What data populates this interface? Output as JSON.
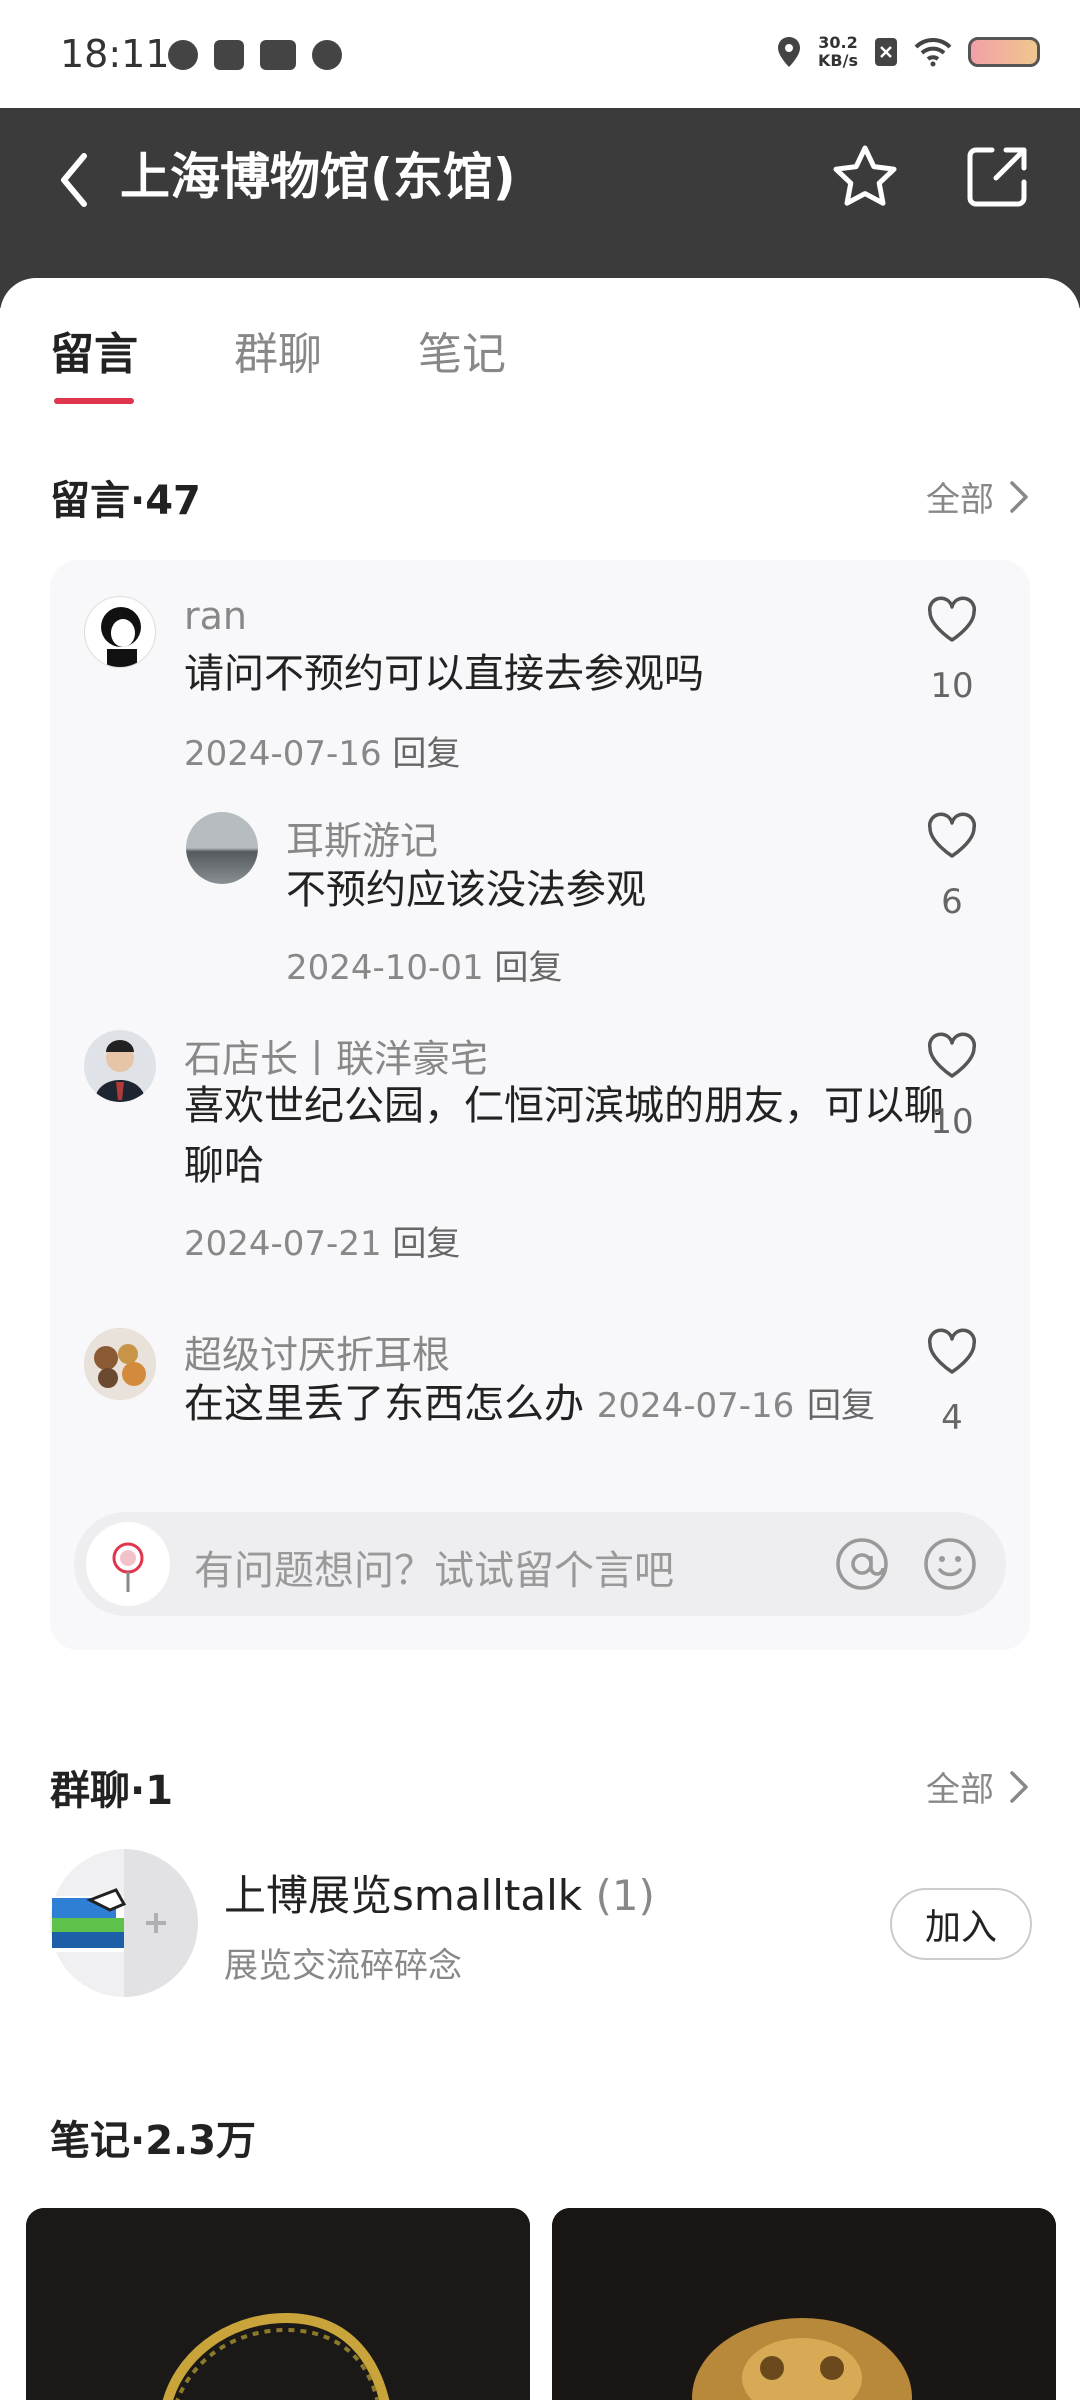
{
  "status_bar": {
    "time": "18:11",
    "speed_value": "30.2",
    "speed_unit": "KB/s"
  },
  "header": {
    "title": "上海博物馆(东馆)"
  },
  "tabs": [
    {
      "label": "留言",
      "active": true
    },
    {
      "label": "群聊",
      "active": false
    },
    {
      "label": "笔记",
      "active": false
    }
  ],
  "comments_section": {
    "title": "留言·47",
    "more_label": "全部",
    "comments": [
      {
        "user": "ran",
        "text": "请问不预约可以直接去参观吗",
        "date": "2024-07-16",
        "reply_label": "回复",
        "likes": "10"
      },
      {
        "user": "耳斯游记",
        "text": "不预约应该没法参观",
        "date": "2024-10-01",
        "reply_label": "回复",
        "likes": "6"
      },
      {
        "user": "石店长丨联洋豪宅",
        "text": "喜欢世纪公园，仁恒河滨城的朋友，可以聊聊哈",
        "date": "2024-07-21",
        "reply_label": "回复",
        "likes": "10"
      },
      {
        "user": "超级讨厌折耳根",
        "text": "在这里丢了东西怎么办",
        "date": "2024-07-16",
        "reply_label": "回复",
        "likes": "4"
      }
    ],
    "input_placeholder": "有问题想问？试试留个言吧"
  },
  "group_section": {
    "title": "群聊·1",
    "more_label": "全部",
    "group_name": "上博展览smalltalk",
    "group_count": "(1)",
    "group_desc": "展览交流碎碎念",
    "join_label": "加入"
  },
  "notes_section": {
    "title": "笔记·2.3万"
  },
  "colors": {
    "header_bg": "#3b3b3b",
    "accent": "#e0364d"
  }
}
